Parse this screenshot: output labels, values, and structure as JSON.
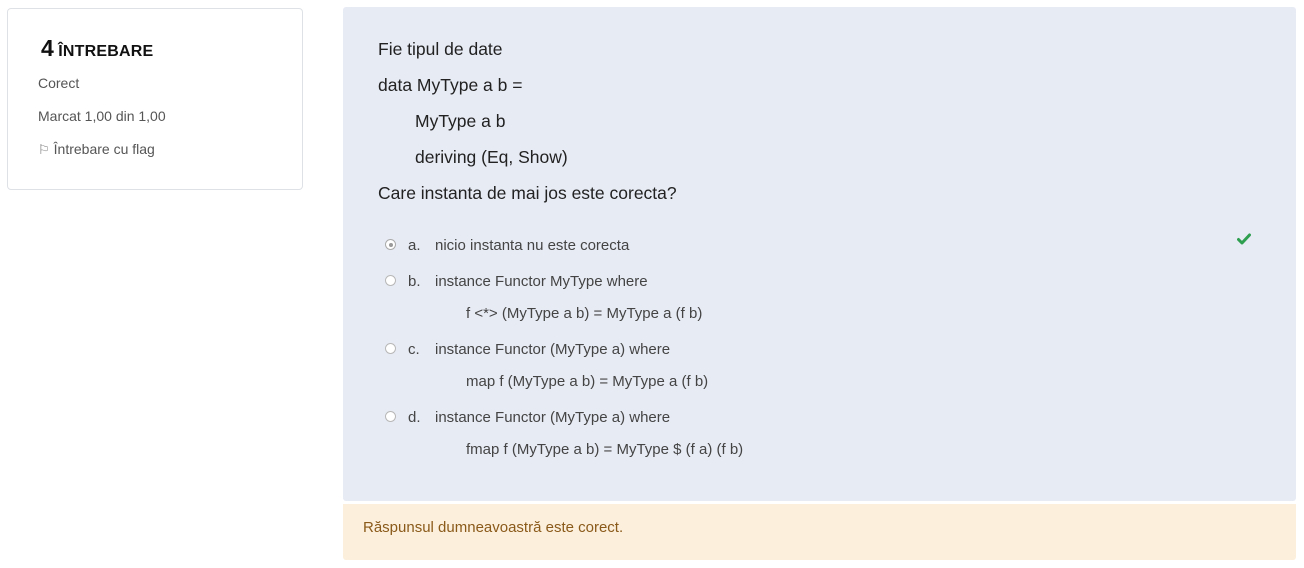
{
  "info": {
    "number": "4",
    "label": "ÎNTREBARE",
    "state": "Corect",
    "grade": "Marcat 1,00 din 1,00",
    "flag_label": "Întrebare cu flag"
  },
  "question": {
    "lines": [
      "Fie tipul de date",
      "data MyType a b =",
      "MyType a b",
      "deriving (Eq, Show)",
      "Care instanta de mai jos este corecta?"
    ]
  },
  "options": [
    {
      "letter": "a.",
      "text": "nicio instanta nu este corecta",
      "code": "",
      "selected": true,
      "correct": true
    },
    {
      "letter": "b.",
      "text": "instance Functor MyType where",
      "code": "f <*> (MyType a b) = MyType a (f b)",
      "selected": false
    },
    {
      "letter": "c.",
      "text": "instance Functor (MyType a) where",
      "code": "map f (MyType a b) = MyType a (f b)",
      "selected": false
    },
    {
      "letter": "d.",
      "text": "instance Functor (MyType a) where",
      "code": "fmap f (MyType a b) = MyType $ (f a) (f b)",
      "selected": false
    }
  ],
  "feedback": "Răspunsul dumneavoastră este corect.",
  "colors": {
    "check": "#2e9e4f",
    "feedback_bg": "#fcefdc",
    "content_bg": "#e7ebf4"
  }
}
